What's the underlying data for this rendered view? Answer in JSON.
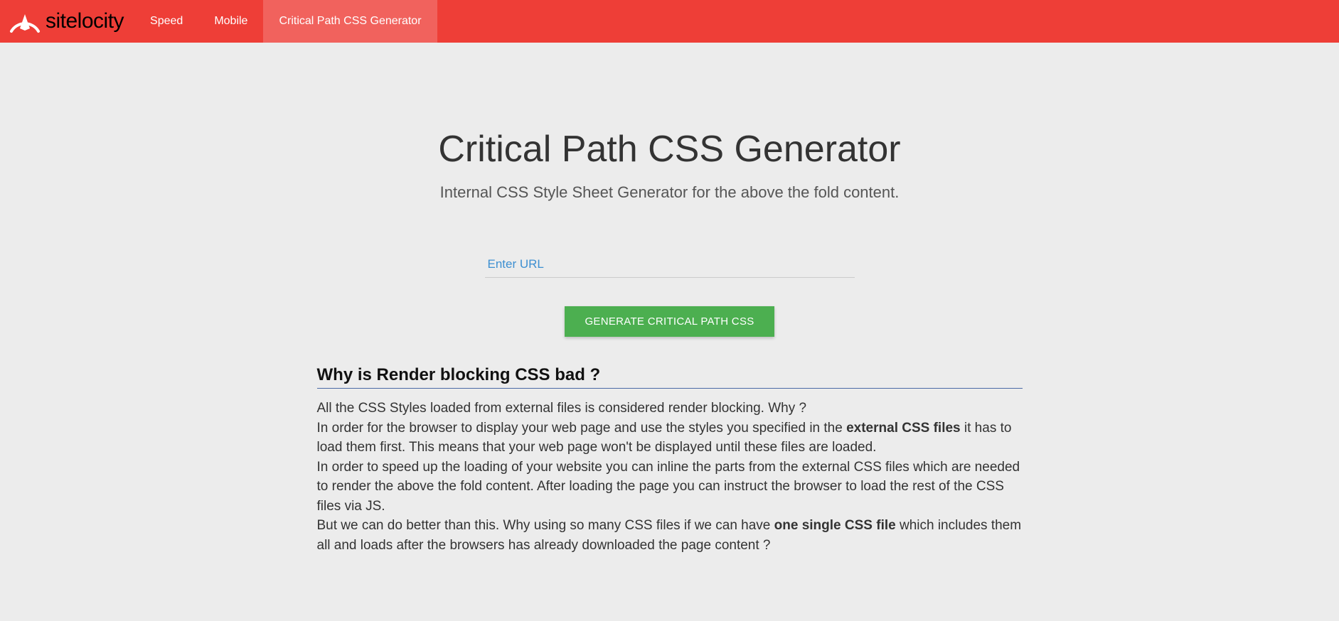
{
  "header": {
    "logo_text": "sitelocity",
    "nav": [
      {
        "label": "Speed",
        "active": false
      },
      {
        "label": "Mobile",
        "active": false
      },
      {
        "label": "Critical Path CSS Generator",
        "active": true
      }
    ]
  },
  "hero": {
    "title": "Critical Path CSS Generator",
    "subtitle": "Internal CSS Style Sheet Generator for the above the fold content."
  },
  "form": {
    "url_placeholder": "Enter URL",
    "url_value": "",
    "generate_label": "GENERATE CRITICAL PATH CSS"
  },
  "section": {
    "title": "Why is Render blocking CSS bad ?",
    "p1": "All the CSS Styles loaded from external files is considered render blocking. Why ?",
    "p2a": "In order for the browser to display your web page and use the styles you specified in the ",
    "p2b_bold": "external CSS files",
    "p2c": " it has to load them first. This means that your web page won't be displayed until these files are loaded.",
    "p3": "In order to speed up the loading of your website you can inline the parts from the external CSS files which are needed to render the above the fold content. After loading the page you can instruct the browser to load the rest of the CSS files via JS.",
    "p4a": "But we can do better than this. Why using so many CSS files if we can have ",
    "p4b_bold": "one single CSS file",
    "p4c": " which includes them all and loads after the browsers has already downloaded the page content ?"
  }
}
